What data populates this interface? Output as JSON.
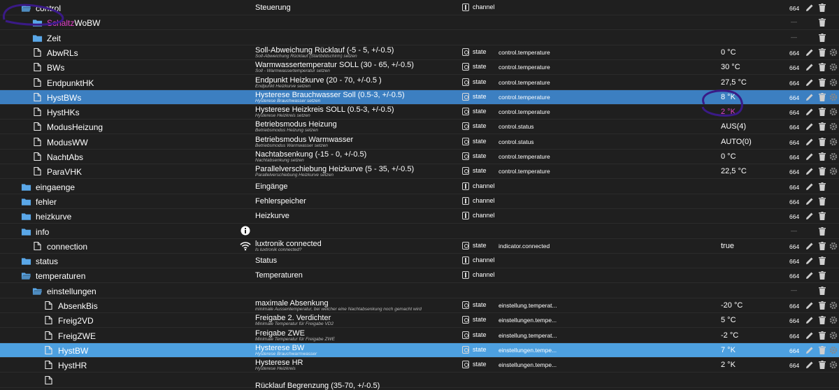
{
  "rows": [
    {
      "name": "control",
      "icon": "folder-open-icon",
      "indent": 0,
      "desc": "Steuerung",
      "sub": "",
      "type": "channel",
      "role": "",
      "value": "",
      "acl": "664",
      "actions": "edit-del",
      "dash": false
    },
    {
      "name": "SchaltzWoBW",
      "namePrefix": "Schaltz",
      "nameRest": "WoBW",
      "icon": "folder-icon",
      "indent": 1,
      "desc": "",
      "sub": "",
      "type": "",
      "role": "",
      "value": "",
      "acl": "",
      "actions": "del",
      "dash": true
    },
    {
      "name": "Zeit",
      "icon": "folder-icon",
      "indent": 1,
      "desc": "",
      "sub": "",
      "type": "",
      "role": "",
      "value": "",
      "acl": "",
      "actions": "del",
      "dash": true
    },
    {
      "name": "AbwRLs",
      "icon": "file-icon",
      "indent": 1,
      "desc": "Soll-Abweichung Rücklauf (-5 - 5, +/-0.5)",
      "sub": "Soll-Abweichung Rücklauf (Startbildschirm) setzen",
      "type": "state",
      "role": "control.temperature",
      "value": "0 °C",
      "acl": "664",
      "actions": "all"
    },
    {
      "name": "BWs",
      "icon": "file-icon",
      "indent": 1,
      "desc": "Warmwassertemperatur SOLL (30 - 65, +/-0.5)",
      "sub": "Soll - Warmwassertemperatur setzen",
      "type": "state",
      "role": "control.temperature",
      "value": "30 °C",
      "acl": "664",
      "actions": "all"
    },
    {
      "name": "EndpunktHK",
      "icon": "file-icon",
      "indent": 1,
      "desc": "Endpunkt Heizkurve (20 - 70, +/-0.5 )",
      "sub": "Endpunkt Heizkurve setzen",
      "type": "state",
      "role": "control.temperature",
      "value": "27,5 °C",
      "acl": "664",
      "actions": "all"
    },
    {
      "name": "HystBWs",
      "icon": "file-icon",
      "indent": 1,
      "desc": "Hysterese Brauchwasser Soll (0.5-3, +/-0.5)",
      "sub": "Hysterese Brauchwasser setzen",
      "type": "state",
      "role": "control.temperature",
      "value": "8 °K",
      "acl": "664",
      "actions": "all",
      "sel": "selected"
    },
    {
      "name": "HystHKs",
      "icon": "file-icon",
      "indent": 1,
      "desc": "Hysterese Heizkreis SOLL (0.5-3, +/-0.5)",
      "sub": "Hysterese Heizkreis setzen",
      "type": "state",
      "role": "control.temperature",
      "value": "2 °K",
      "acl": "664",
      "actions": "all"
    },
    {
      "name": "ModusHeizung",
      "icon": "file-icon",
      "indent": 1,
      "desc": "Betriebsmodus Heizung",
      "sub": "Betriebsmodus Heizung setzen",
      "type": "state",
      "role": "control.status",
      "value": "AUS(4)",
      "acl": "664",
      "actions": "all"
    },
    {
      "name": "ModusWW",
      "icon": "file-icon",
      "indent": 1,
      "desc": "Betriebsmodus Warmwasser",
      "sub": "Betriebsmodus Warmwasser setzen",
      "type": "state",
      "role": "control.status",
      "value": "AUTO(0)",
      "acl": "664",
      "actions": "all"
    },
    {
      "name": "NachtAbs",
      "icon": "file-icon",
      "indent": 1,
      "desc": "Nachtabsenkung (-15 - 0, +/-0.5)",
      "sub": "Nachtabsenkung setzen",
      "type": "state",
      "role": "control.temperature",
      "value": "0 °C",
      "acl": "664",
      "actions": "all"
    },
    {
      "name": "ParaVHK",
      "icon": "file-icon",
      "indent": 1,
      "desc": "Parallelverschiebung Heizkurve (5 - 35, +/-0.5)",
      "sub": "Parallelverschiebung Heizkurve setzen",
      "type": "state",
      "role": "control.temperature",
      "value": "22,5 °C",
      "acl": "664",
      "actions": "all"
    },
    {
      "name": "eingaenge",
      "icon": "folder-icon",
      "indent": 0,
      "desc": "Eingänge",
      "sub": "",
      "type": "channel",
      "role": "",
      "value": "",
      "acl": "664",
      "actions": "edit-del"
    },
    {
      "name": "fehler",
      "icon": "folder-icon",
      "indent": 0,
      "desc": "Fehlerspeicher",
      "sub": "",
      "type": "channel",
      "role": "",
      "value": "",
      "acl": "664",
      "actions": "edit-del"
    },
    {
      "name": "heizkurve",
      "icon": "folder-icon",
      "indent": 0,
      "desc": "Heizkurve",
      "sub": "",
      "type": "channel",
      "role": "",
      "value": "",
      "acl": "664",
      "actions": "edit-del"
    },
    {
      "name": "info",
      "icon": "folder-icon",
      "indent": 0,
      "desc": "",
      "sub": "",
      "type": "",
      "role": "",
      "value": "",
      "acl": "",
      "actions": "del",
      "dash": true,
      "infoIcon": true
    },
    {
      "name": "connection",
      "icon": "file-icon",
      "indent": 1,
      "desc": "luxtronik connected",
      "sub": "Is luxtronik connected?",
      "type": "state",
      "role": "indicator.connected",
      "value": "true",
      "acl": "664",
      "actions": "all",
      "wifiIcon": true
    },
    {
      "name": "status",
      "icon": "folder-icon",
      "indent": 0,
      "desc": "Status",
      "sub": "",
      "type": "channel",
      "role": "",
      "value": "",
      "acl": "664",
      "actions": "edit-del"
    },
    {
      "name": "temperaturen",
      "icon": "folder-open-icon",
      "indent": 0,
      "desc": "Temperaturen",
      "sub": "",
      "type": "channel",
      "role": "",
      "value": "",
      "acl": "664",
      "actions": "edit-del"
    },
    {
      "name": "einstellungen",
      "icon": "folder-open-icon",
      "indent": 1,
      "desc": "",
      "sub": "",
      "type": "",
      "role": "",
      "value": "",
      "acl": "",
      "actions": "del",
      "dash": true
    },
    {
      "name": "AbsenkBis",
      "icon": "file-icon",
      "indent": 2,
      "desc": "maximale Absenkung",
      "sub": "minimale Aussentemperatur, bei welcher eine Nachtabsenkung noch gemacht wird",
      "type": "state",
      "role": "einstellung.temperat...",
      "value": "-20 °C",
      "acl": "664",
      "actions": "all"
    },
    {
      "name": "Freig2VD",
      "icon": "file-icon",
      "indent": 2,
      "desc": "Freigabe 2. Verdichter",
      "sub": "Minimale Temperatur für Freigabe VD2",
      "type": "state",
      "role": "einstellungen.tempe...",
      "value": "5 °C",
      "acl": "664",
      "actions": "all"
    },
    {
      "name": "FreigZWE",
      "icon": "file-icon",
      "indent": 2,
      "desc": "Freigabe ZWE",
      "sub": "Minimale Temperatur für Freigabe ZWE",
      "type": "state",
      "role": "einstellung.temperat...",
      "value": "-2 °C",
      "acl": "664",
      "actions": "all"
    },
    {
      "name": "HystBW",
      "icon": "file-icon",
      "indent": 2,
      "desc": "Hysterese BW",
      "sub": "Hysterese Brauchwarmwasser",
      "type": "state",
      "role": "einstellungen.tempe...",
      "value": "7 °K",
      "acl": "664",
      "actions": "all",
      "sel": "selected2"
    },
    {
      "name": "HystHR",
      "icon": "file-icon",
      "indent": 2,
      "desc": "Hysterese HR",
      "sub": "Hysterese Heizkreis",
      "type": "state",
      "role": "einstellungen.tempe...",
      "value": "2 °K",
      "acl": "664",
      "actions": "all"
    },
    {
      "name": "",
      "icon": "file-icon",
      "indent": 2,
      "desc": "Rücklauf Begrenzung (35-70, +/-0.5)",
      "sub": "",
      "type": "",
      "role": "",
      "value": "",
      "acl": "",
      "actions": "none",
      "partial": true
    }
  ],
  "colors": {
    "selected": "#3c7fc1",
    "selected2": "#4da0e0",
    "folder": "#5aa7e8",
    "annotation": "#3a1a86",
    "pink": "#e040c8"
  }
}
